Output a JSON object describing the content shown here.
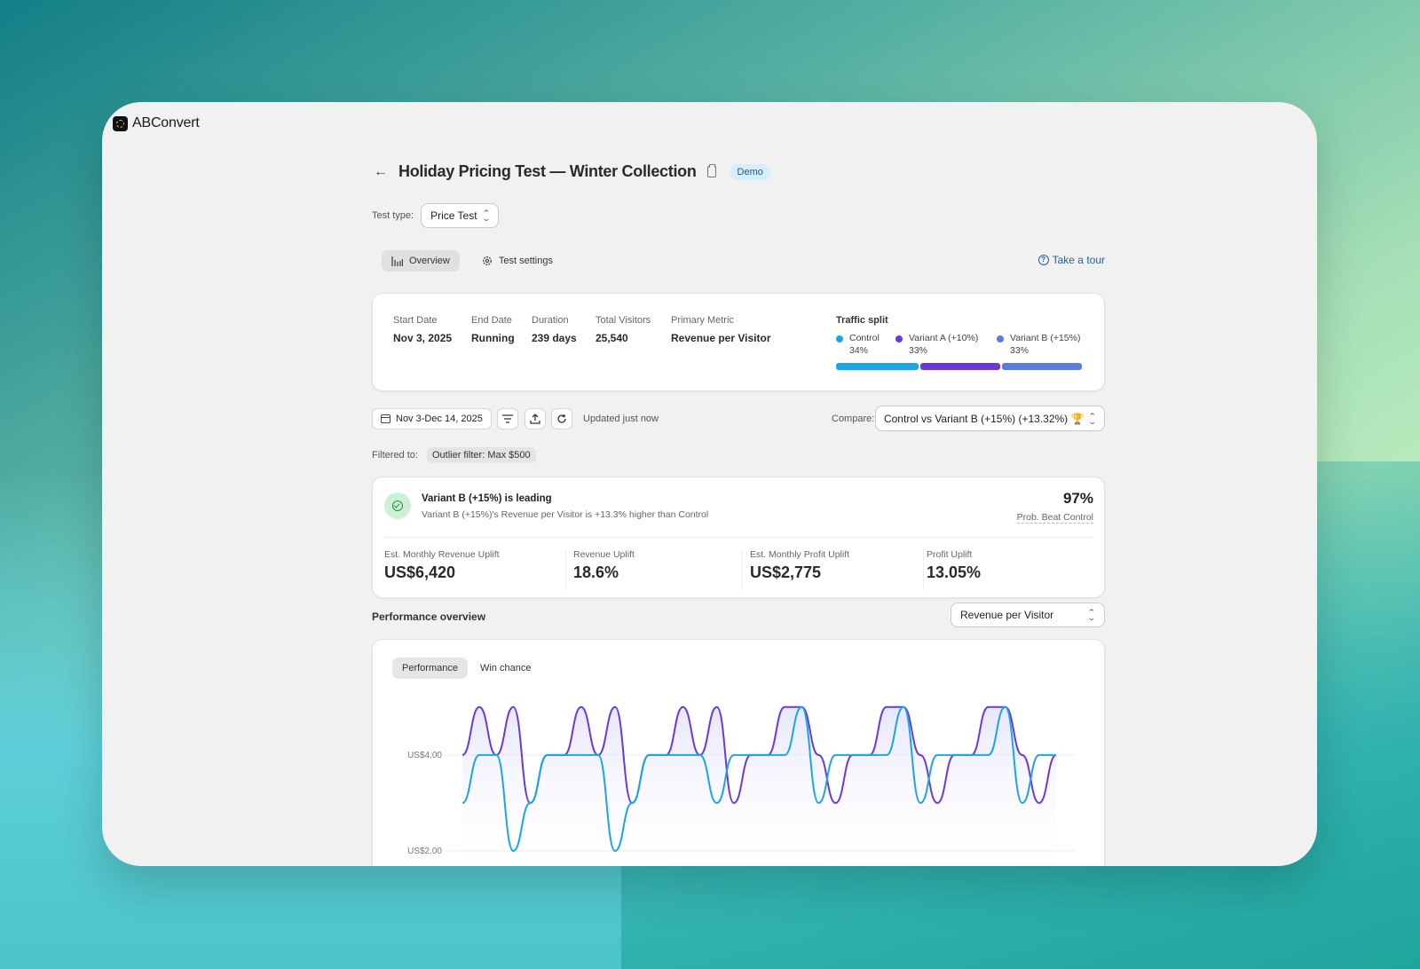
{
  "app": {
    "name": "ABConvert"
  },
  "header": {
    "title": "Holiday Pricing Test — Winter Collection",
    "badge": "Demo",
    "test_type_label": "Test type:",
    "test_type_value": "Price Test"
  },
  "tabs": [
    {
      "label": "Overview",
      "icon": "bar-chart-icon",
      "active": true
    },
    {
      "label": "Test settings",
      "icon": "gear-icon",
      "active": false
    }
  ],
  "tour": {
    "label": "Take a tour"
  },
  "summary": {
    "stats": [
      {
        "label": "Start Date",
        "value": "Nov 3, 2025"
      },
      {
        "label": "End Date",
        "value": "Running"
      },
      {
        "label": "Duration",
        "value": "239 days"
      },
      {
        "label": "Total Visitors",
        "value": "25,540"
      },
      {
        "label": "Primary Metric",
        "value": "Revenue per Visitor"
      }
    ],
    "traffic": {
      "label": "Traffic split",
      "items": [
        {
          "name": "Control",
          "pct": "34%",
          "share": 34,
          "color": "#1ba6e3"
        },
        {
          "name": "Variant A (+10%)",
          "pct": "33%",
          "share": 33,
          "color": "#6a3ad6"
        },
        {
          "name": "Variant B (+15%)",
          "pct": "33%",
          "share": 33,
          "color": "#5b7be0"
        }
      ]
    }
  },
  "toolbar": {
    "date_range": "Nov 3-Dec 14, 2025",
    "updated": "Updated just now",
    "compare_label": "Compare:",
    "compare_value": "Control vs Variant B (+15%) (+13.32%) 🏆"
  },
  "filter": {
    "label": "Filtered to:",
    "chip": "Outlier filter: Max $500"
  },
  "result": {
    "title": "Variant B (+15%) is leading",
    "subtitle": "Variant B (+15%)'s Revenue per Visitor is +13.3% higher than Control",
    "prob_value": "97%",
    "prob_label": "Prob. Beat Control",
    "metrics": [
      {
        "label": "Est. Monthly Revenue Uplift",
        "value": "US$6,420"
      },
      {
        "label": "Revenue Uplift",
        "value": "18.6%"
      },
      {
        "label": "Est. Monthly Profit Uplift",
        "value": "US$2,775"
      },
      {
        "label": "Profit Uplift",
        "value": "13.05%"
      }
    ]
  },
  "performance": {
    "title": "Performance overview",
    "metric_select": "Revenue per Visitor",
    "tabs": [
      {
        "label": "Performance",
        "active": true
      },
      {
        "label": "Win chance",
        "active": false
      }
    ]
  },
  "chart_data": {
    "type": "line",
    "title": "",
    "xlabel": "",
    "ylabel": "",
    "yticks": [
      "US$4.00",
      "US$2.00"
    ],
    "ylim": [
      1.5,
      5.2
    ],
    "grid": true,
    "series": [
      {
        "color": "#6a3ad6",
        "values": [
          4,
          5,
          4,
          5,
          3,
          4,
          4,
          5,
          4,
          5,
          3,
          4,
          4,
          5,
          4,
          5,
          3,
          4,
          4,
          5,
          5,
          4,
          3,
          4,
          4,
          5,
          5,
          4,
          3,
          4,
          4,
          5,
          5,
          4,
          3,
          4
        ]
      },
      {
        "color": "#1ba6e3",
        "values": [
          3,
          4,
          4,
          2,
          3,
          4,
          4,
          4,
          4,
          2,
          3,
          4,
          4,
          4,
          4,
          3,
          4,
          4,
          4,
          4,
          5,
          3,
          4,
          4,
          4,
          4,
          5,
          3,
          4,
          4,
          4,
          4,
          5,
          3,
          4,
          4
        ]
      }
    ]
  }
}
